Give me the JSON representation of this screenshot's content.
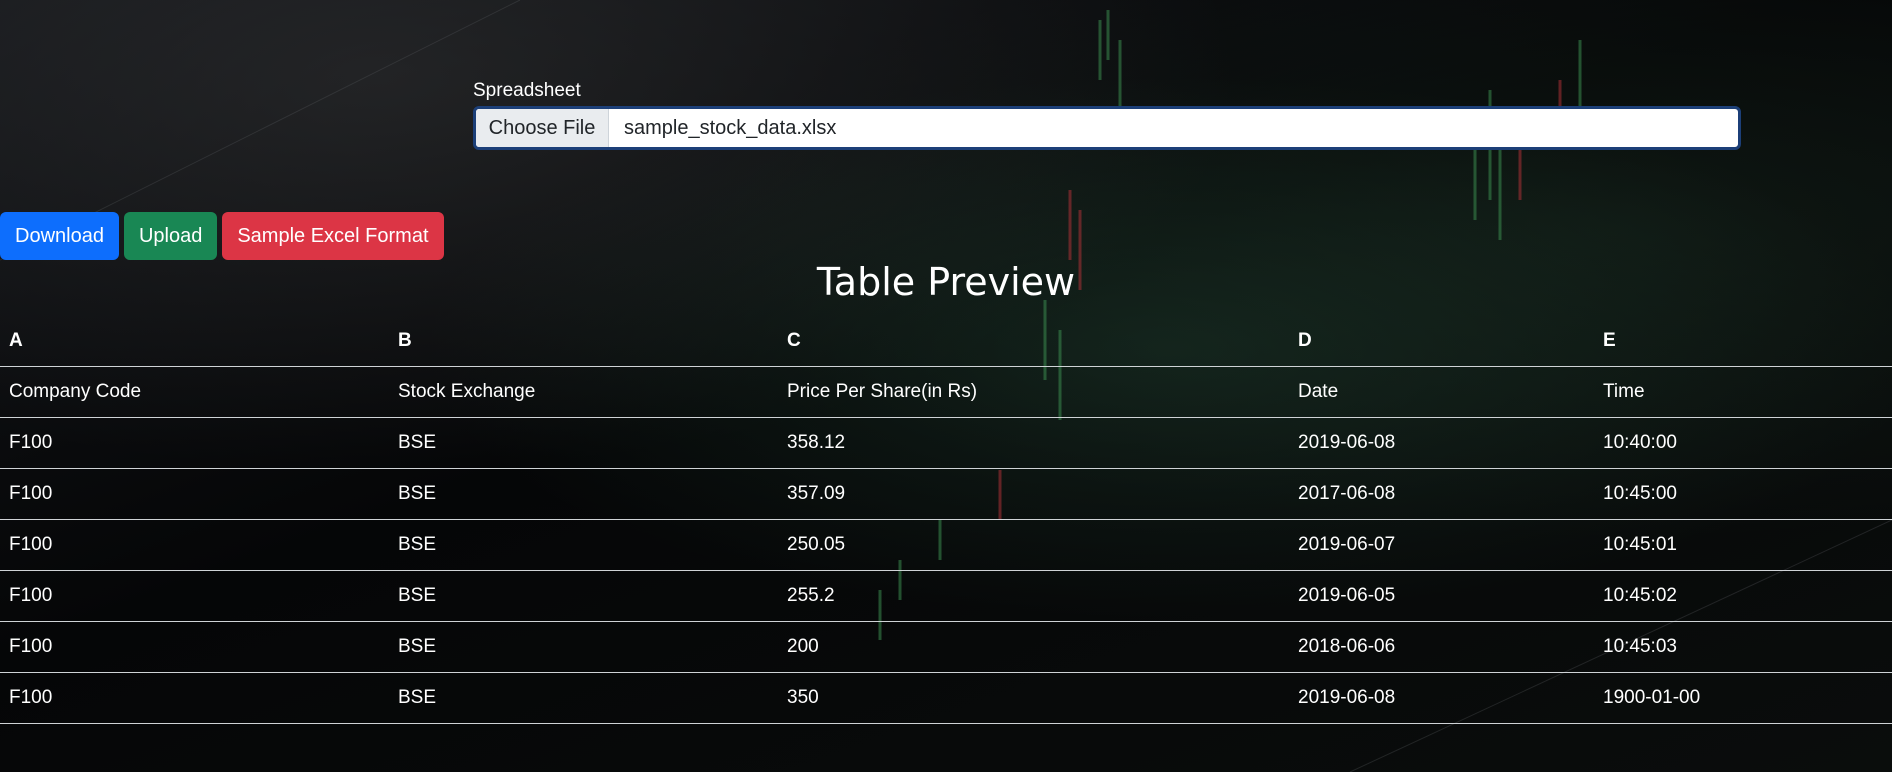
{
  "upload": {
    "label": "Spreadsheet",
    "choose_label": "Choose File",
    "file_name": "sample_stock_data.xlsx"
  },
  "buttons": {
    "download": "Download",
    "upload": "Upload",
    "sample": "Sample Excel Format"
  },
  "colors": {
    "primary": "#0d6efd",
    "success": "#198754",
    "danger": "#dc3545"
  },
  "table": {
    "title": "Table Preview",
    "columns": [
      "A",
      "B",
      "C",
      "D",
      "E"
    ],
    "rows": [
      [
        "Company Code",
        "Stock Exchange",
        "Price Per Share(in Rs)",
        "Date",
        "Time"
      ],
      [
        "F100",
        "BSE",
        "358.12",
        "2019-06-08",
        "10:40:00"
      ],
      [
        "F100",
        "BSE",
        "357.09",
        "2017-06-08",
        "10:45:00"
      ],
      [
        "F100",
        "BSE",
        "250.05",
        "2019-06-07",
        "10:45:01"
      ],
      [
        "F100",
        "BSE",
        "255.2",
        "2019-06-05",
        "10:45:02"
      ],
      [
        "F100",
        "BSE",
        "200",
        "2018-06-06",
        "10:45:03"
      ],
      [
        "F100",
        "BSE",
        "350",
        "2019-06-08",
        "1900-01-00"
      ]
    ]
  }
}
